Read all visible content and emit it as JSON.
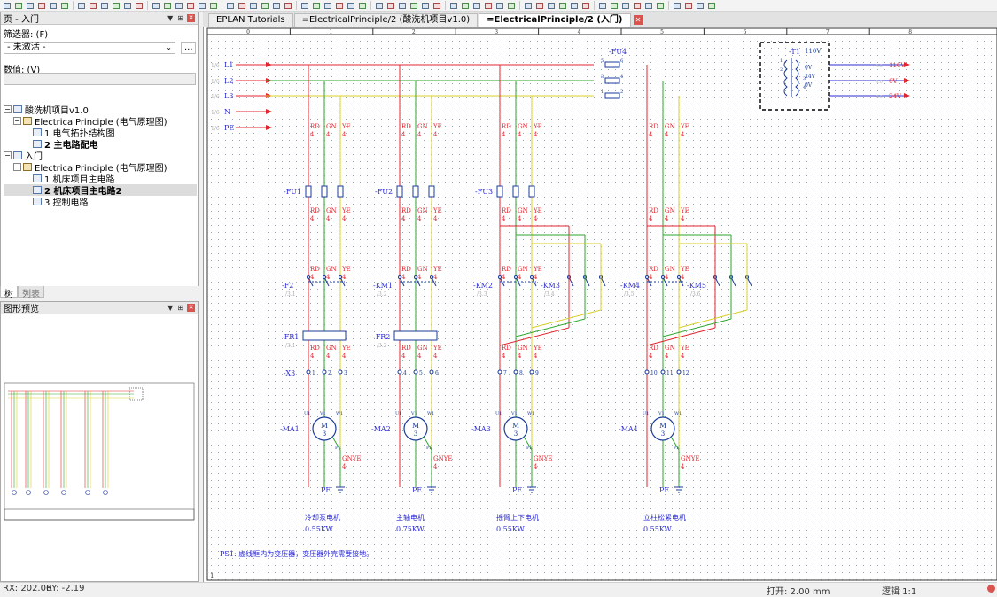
{
  "toolbar": {
    "button_count": 58
  },
  "pages_panel": {
    "title": "页 - 入门",
    "filter_label": "筛选器: (F)",
    "filter_value": "- 未激活 -",
    "filter_more": "...",
    "value_label": "数值: (V)",
    "tree": [
      {
        "level": 0,
        "toggle": "−",
        "icon": "page",
        "label": "酸洗机项目v1.0",
        "bold": false
      },
      {
        "level": 1,
        "toggle": "−",
        "icon": "db",
        "label": "ElectricalPrinciple (电气原理图)",
        "bold": false
      },
      {
        "level": 2,
        "toggle": "",
        "icon": "page",
        "label": "1 电气拓扑结构图",
        "bold": false
      },
      {
        "level": 2,
        "toggle": "",
        "icon": "page",
        "label": "2 主电路配电",
        "bold": true
      },
      {
        "level": 0,
        "toggle": "−",
        "icon": "page",
        "label": "入门",
        "bold": false
      },
      {
        "level": 1,
        "toggle": "−",
        "icon": "db",
        "label": "ElectricalPrinciple (电气原理图)",
        "bold": false
      },
      {
        "level": 2,
        "toggle": "",
        "icon": "page",
        "label": "1 机床项目主电路",
        "bold": false
      },
      {
        "level": 2,
        "toggle": "",
        "icon": "page",
        "label": "2 机床项目主电路2",
        "bold": true,
        "selected": true
      },
      {
        "level": 2,
        "toggle": "",
        "icon": "page",
        "label": "3 控制电路",
        "bold": false
      }
    ],
    "tabs": [
      "树",
      "列表"
    ]
  },
  "preview_panel": {
    "title": "图形预览"
  },
  "doc_tabs": [
    {
      "label": "EPLAN Tutorials",
      "active": false
    },
    {
      "label": "=ElectricalPrinciple/2 (酸洗机项目v1.0)",
      "active": false
    },
    {
      "label": "=ElectricalPrinciple/2 (入门)",
      "active": true
    }
  ],
  "schematic": {
    "colors": {
      "rd": "#e0262f",
      "gn": "#2ea62e",
      "ye": "#d8cf2a",
      "wire_dark": "#222222",
      "text_blue": "#2b2bd1",
      "sym": "#1a3a9a"
    },
    "ruler": [
      "0",
      "1",
      "2",
      "3",
      "4",
      "5",
      "6",
      "7",
      "8"
    ],
    "bus": [
      {
        "ref": "1/6",
        "name": "L1"
      },
      {
        "ref": "1/6",
        "name": "L2"
      },
      {
        "ref": "1/6",
        "name": "L3"
      },
      {
        "ref": "1/6",
        "name": "N"
      },
      {
        "ref": "1/6",
        "name": "PE"
      }
    ],
    "color_codes": [
      "RD",
      "GN",
      "YE"
    ],
    "wire_cross": "4",
    "gnye": "GNYE",
    "pe": "PE",
    "fuses": [
      "-FU1",
      "-FU2",
      "-FU3",
      "-FU4"
    ],
    "contactors": [
      "-F2",
      "-KM1",
      "-KM2",
      "-KM3",
      "-KM4",
      "-KM5"
    ],
    "contactor_refs": [
      "/3.1",
      "/3.2",
      "/3.3",
      "/3.4",
      "/3.5",
      "/3.6"
    ],
    "overloads": [
      "-FR1",
      "-FR2"
    ],
    "overload_refs": [
      "/3.1",
      "/3.2"
    ],
    "terminal_strip": "-X3",
    "terminal_numbers": [
      "1",
      "2",
      "3",
      "4",
      "5",
      "6",
      "7",
      "8",
      "9",
      "10",
      "11",
      "12"
    ],
    "motors": [
      {
        "tag": "-MA1",
        "desc": "冷却泵电机",
        "power": "0.55KW"
      },
      {
        "tag": "-MA2",
        "desc": "主轴电机",
        "power": "0.75KW"
      },
      {
        "tag": "-MA3",
        "desc": "摇臂上下电机",
        "power": "0.55KW"
      },
      {
        "tag": "-MA4",
        "desc": "立柱松紧电机",
        "power": "0.55KW"
      }
    ],
    "motor_symbol": {
      "m": "M",
      "n": "3",
      "pins": [
        "U1",
        "V1",
        "W1"
      ],
      "pe_label": "PE"
    },
    "transformer": {
      "tag": "-T1",
      "primary": "110V",
      "taps": [
        "0V",
        "24V",
        "0V"
      ],
      "pins": [
        "1",
        "2",
        "3",
        "4"
      ],
      "outputs": [
        {
          "ref": "3.0",
          "label": "110V"
        },
        {
          "ref": "3.0",
          "label": "0V"
        },
        {
          "ref": "3.0",
          "label": "24V"
        }
      ]
    },
    "fu4_pins": [
      "5",
      "6",
      "3",
      "4",
      "1",
      "2"
    ],
    "note": "PS1: 虚线框内为变压器，变压器外壳需要接地。",
    "sheet_page_number": "1"
  },
  "status": {
    "rx": "RX: 202.06",
    "ry": "RY: -2.19",
    "grid": "打开: 2.00 mm",
    "logic": "逻辑 1:1"
  }
}
